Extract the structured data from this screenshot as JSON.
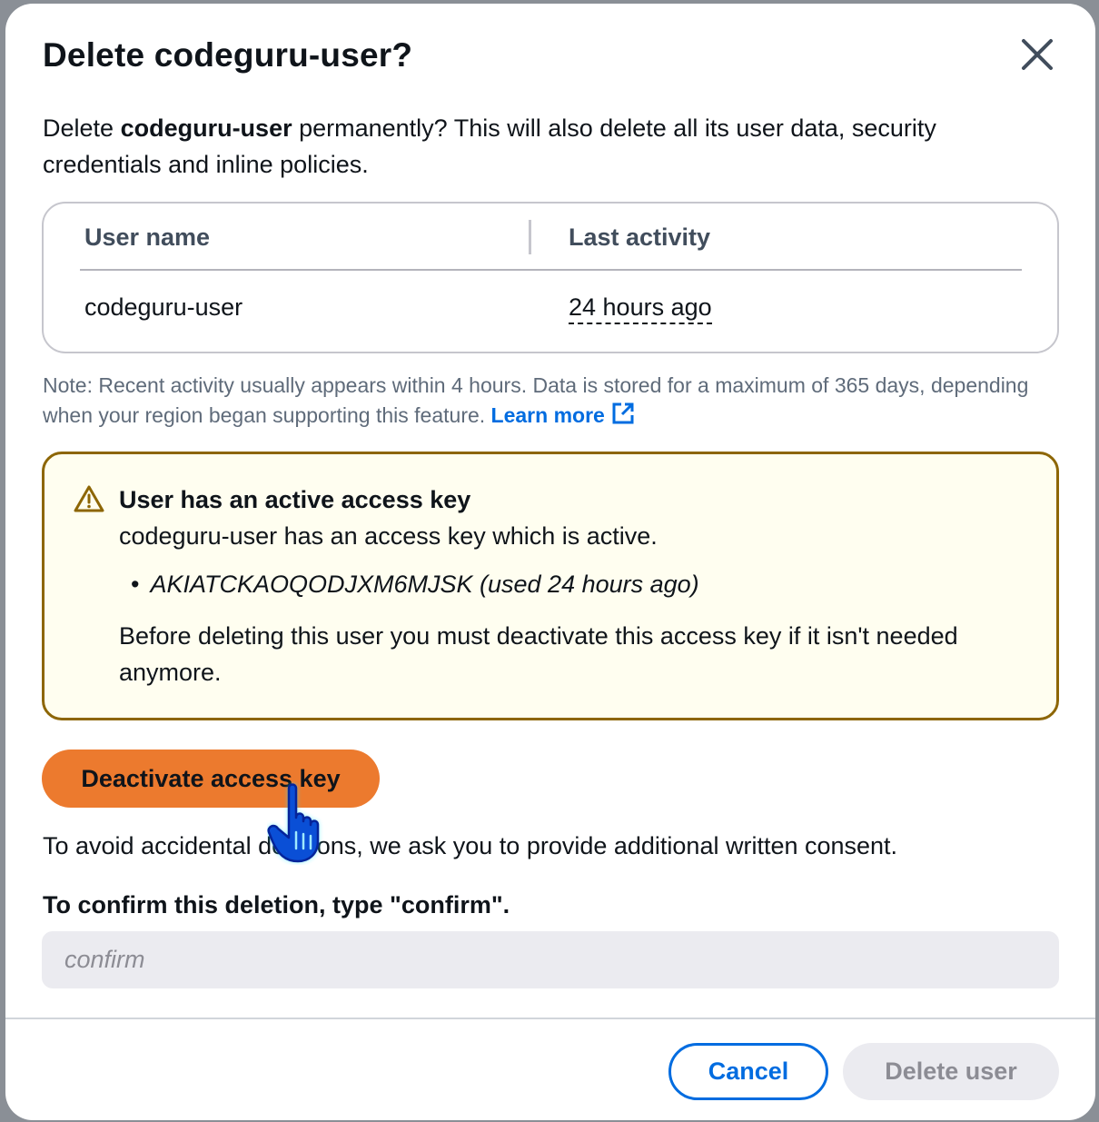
{
  "modal": {
    "title": "Delete codeguru-user?",
    "description_prefix": "Delete ",
    "description_bold": "codeguru-user",
    "description_suffix": " permanently? This will also delete all its user data, security credentials and inline policies."
  },
  "table": {
    "headers": [
      "User name",
      "Last activity"
    ],
    "rows": [
      {
        "user_name": "codeguru-user",
        "last_activity": "24 hours ago"
      }
    ]
  },
  "note": {
    "text": "Note: Recent activity usually appears within 4 hours. Data is stored for a maximum of 365 days, depending when your region began supporting this feature. ",
    "link_label": "Learn more"
  },
  "alert": {
    "title": "User has an active access key",
    "body": "codeguru-user has an access key which is active.",
    "bullet": "•",
    "key_item": "AKIATCKAOQODJXM6MJSK (used 24 hours ago)",
    "warning": "Before deleting this user you must deactivate this access key if it isn't needed anymore."
  },
  "actions": {
    "deactivate_label": "Deactivate access key",
    "consent_text": "To avoid accidental deletions, we ask you to provide additional written consent.",
    "confirm_label": "To confirm this deletion, type \"confirm\".",
    "confirm_value": "",
    "confirm_placeholder": "confirm",
    "cancel_label": "Cancel",
    "delete_label": "Delete user"
  },
  "colors": {
    "primary_orange": "#ec7a2e",
    "link_blue": "#006ce0",
    "warning_border": "#8d6605",
    "warning_bg": "#fffef0"
  },
  "icons": {
    "close": "close-icon",
    "warning": "warning-icon",
    "external": "external-link-icon",
    "cursor": "hand-pointer-icon"
  }
}
